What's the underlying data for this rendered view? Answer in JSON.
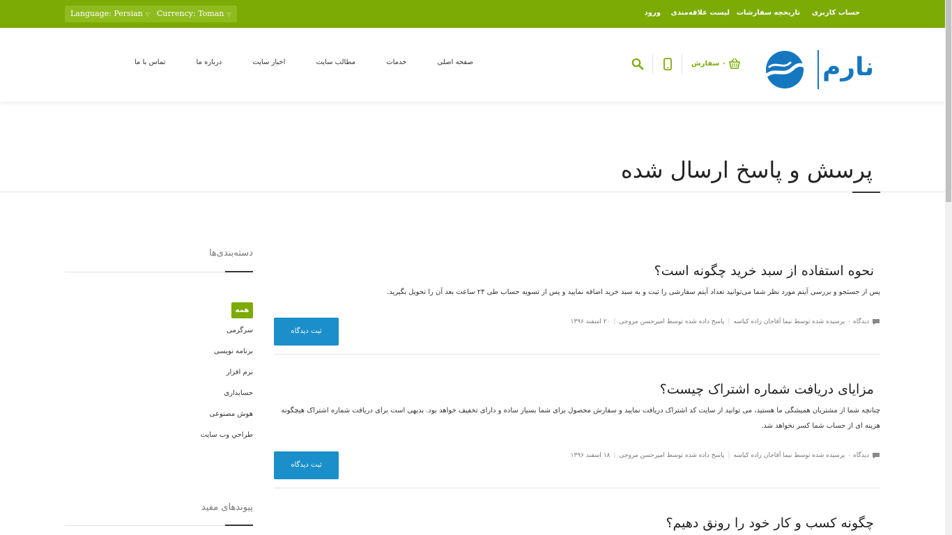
{
  "topbar": {
    "language": "Language: Persian",
    "currency": "Currency: Toman",
    "links": [
      "حساب کاربری",
      "تاریخچه سفارشات",
      "لیست علاقه‌مندی",
      "ورود"
    ]
  },
  "header": {
    "logo_text": "نارم",
    "cart_label": "۰ سفارش",
    "nav": [
      "صفحه اصلی",
      "خدمات",
      "مطالب سایت",
      "اخبار سایت",
      "درباره ما",
      "تماس با ما"
    ]
  },
  "page": {
    "title": "پرسش و پاسخ ارسال شده"
  },
  "sidebar": {
    "categories_heading": "دسته‌بندی‌ها",
    "categories": [
      "همه",
      "سرگرمی",
      "برنامه نویسی",
      "نرم افزار",
      "حسابداری",
      "هوش مصنوعی",
      "طراحي وب سایت"
    ],
    "links_heading": "پیوندهای مفید"
  },
  "posts": [
    {
      "title": "نحوه استفاده از سبد خرید چگونه است؟",
      "body": "پس از جستجو و بررسی آیتم مورد نظر شما می‌توانید تعداد آیتم سفارشی را ثبت و به سبد خرید اضافه نمایید و پس از تسویه حساب طی ۲۴ ساعت بعد آن را تحویل بگیرید.",
      "comments": "دیدگاه ۰",
      "asked_by": "پرسیده شده توسط  نیما آقاجان زاده کیاسه",
      "answered_by": "پاسخ داده شده توسط  امیرحسن مروجی",
      "date": "۲۰ اسفند ۱۳۹۶",
      "button": "ثبت دیدگاه"
    },
    {
      "title": "مزایای دریافت شماره اشتراک چیست؟",
      "body": "چنانچه شما از مشتریان همیشگی ما هستید، می توانید از سایت کد اشتراک دریافت نمایید و سفارش محصول برای شما بسیار ساده و دارای تخفیف خواهد بود. بدیهی است برای دریافت شماره اشتراک هیچگونه هزینه ای از حساب شما کسر نخواهد شد.",
      "comments": "دیدگاه ۰",
      "asked_by": "پرسیده شده توسط  نیما آقاجان زاده کیاسه",
      "answered_by": "پاسخ داده شده توسط  امیرحسن مروجی",
      "date": "۱۸ اسفند ۱۳۹۶",
      "button": "ثبت دیدگاه"
    },
    {
      "title": "چگونه کسب و کار خود را رونق دهیم؟"
    }
  ],
  "colors": {
    "brand_green": "#7cab06",
    "button_blue": "#1a8fc9",
    "logo_blue": "#1577c0"
  }
}
